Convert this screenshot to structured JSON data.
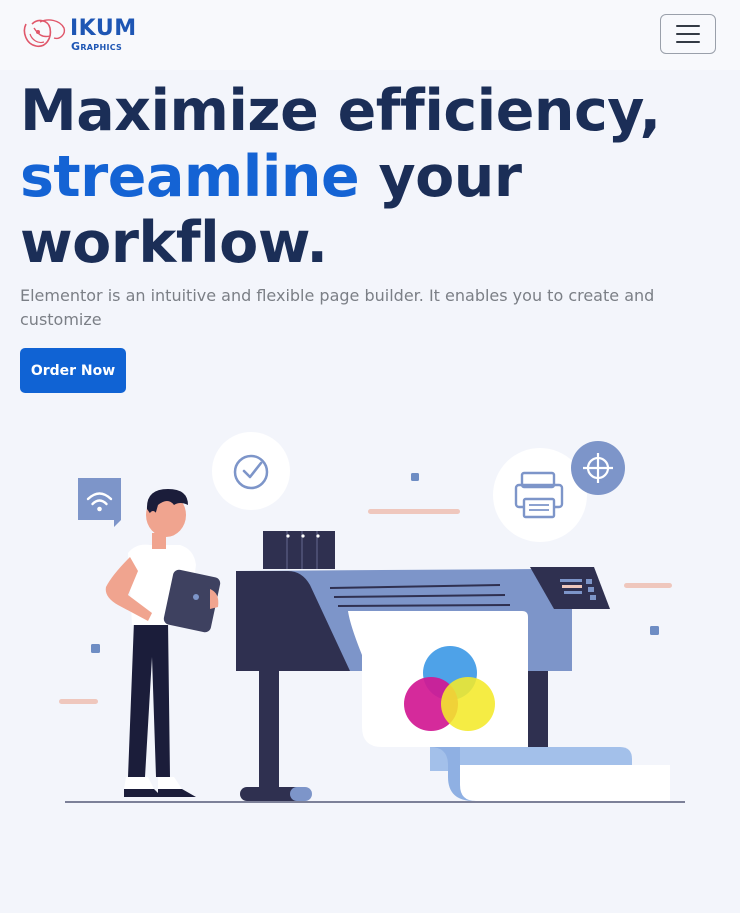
{
  "brand": {
    "name": "IKUM",
    "tagline": "Graphics"
  },
  "nav": {
    "toggle_icon": "hamburger-icon"
  },
  "hero": {
    "title_line1": "Maximize efficiency,",
    "title_accent": "streamline",
    "title_line2_rest": " your",
    "title_line3": "workflow.",
    "subtitle": "Elementor is an intuitive and flexible page builder. It enables you to create and customize",
    "cta_label": "Order Now"
  },
  "colors": {
    "background": "#f3f5fb",
    "heading": "#1b2e57",
    "accent": "#1463d4",
    "button": "#1063d4",
    "brand": "#1e56b4",
    "logo_mark": "#e0576a"
  }
}
